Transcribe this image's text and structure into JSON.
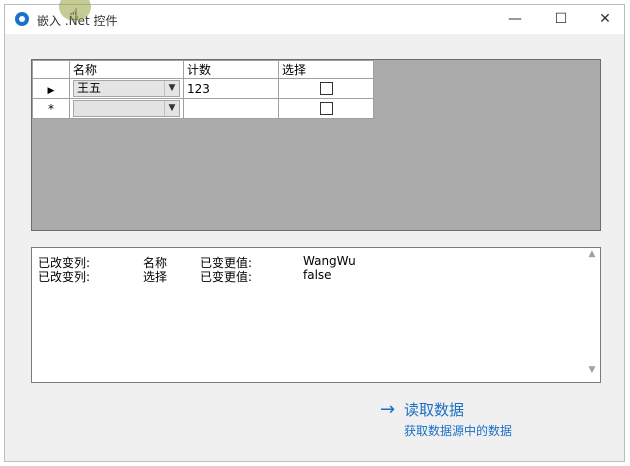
{
  "window": {
    "title": "嵌入 .Net 控件",
    "minimize_glyph": "—",
    "maximize_glyph": "☐",
    "close_glyph": "✕"
  },
  "grid": {
    "columns": [
      "名称",
      "计数",
      "选择"
    ],
    "rows": [
      {
        "indicator": "▶",
        "name": "王五",
        "count": "123",
        "checked": false
      },
      {
        "indicator": "*",
        "name": "",
        "count": "",
        "checked": false
      }
    ]
  },
  "log": {
    "lines": [
      {
        "label": "已改变列:",
        "column": "名称",
        "value_label": "已变更值:",
        "value": "WangWu"
      },
      {
        "label": "已改变列:",
        "column": "选择",
        "value_label": "已变更值:",
        "value": "false"
      }
    ]
  },
  "action": {
    "title": "读取数据",
    "subtitle": "获取数据源中的数据",
    "arrow": "→"
  },
  "colors": {
    "link": "#1a6fc4",
    "grid_background": "#ababab"
  }
}
